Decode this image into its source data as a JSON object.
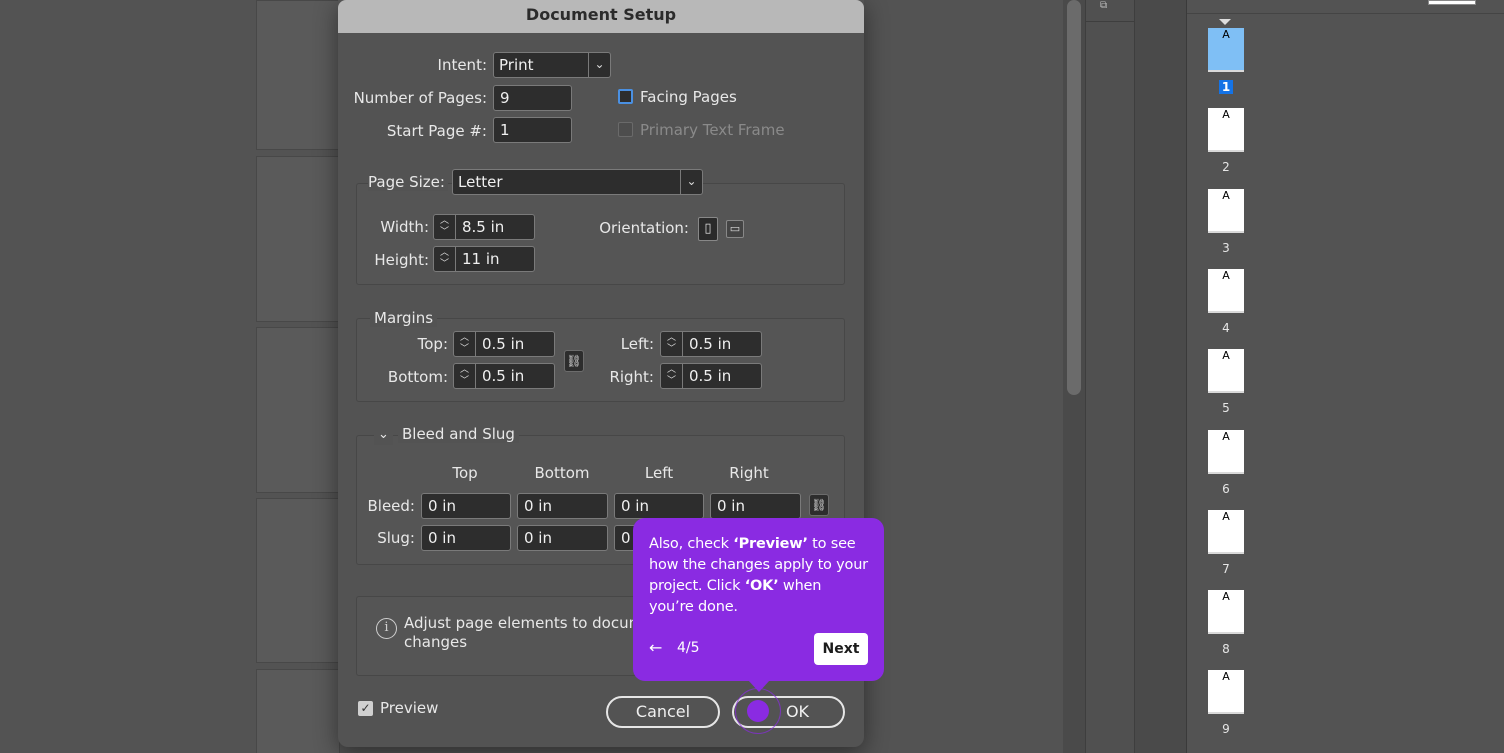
{
  "dialog": {
    "title": "Document Setup",
    "intent_label": "Intent:",
    "intent_value": "Print",
    "num_pages_label": "Number of Pages:",
    "num_pages_value": "9",
    "start_page_label": "Start Page #:",
    "start_page_value": "1",
    "facing_pages_label": "Facing Pages",
    "primary_text_frame_label": "Primary Text Frame",
    "page_size_label": "Page Size:",
    "page_size_value": "Letter",
    "width_label": "Width:",
    "width_value": "8.5 in",
    "height_label": "Height:",
    "height_value": "11 in",
    "orientation_label": "Orientation:",
    "margins_label": "Margins",
    "margin_top_label": "Top:",
    "margin_top_value": "0.5 in",
    "margin_bottom_label": "Bottom:",
    "margin_bottom_value": "0.5 in",
    "margin_left_label": "Left:",
    "margin_left_value": "0.5 in",
    "margin_right_label": "Right:",
    "margin_right_value": "0.5 in",
    "bleed_slug_label": "Bleed and Slug",
    "col_top": "Top",
    "col_bottom": "Bottom",
    "col_left": "Left",
    "col_right": "Right",
    "bleed_label": "Bleed:",
    "slug_label": "Slug:",
    "bleed": {
      "top": "0 in",
      "bottom": "0 in",
      "left": "0 in",
      "right": "0 in"
    },
    "slug": {
      "top": "0 in",
      "bottom": "0 in",
      "left": "0"
    },
    "adjust_line1": "Adjust page elements to docum",
    "adjust_line2": "changes",
    "preview_label": "Preview",
    "cancel_label": "Cancel",
    "ok_label": "OK"
  },
  "tooltip": {
    "text_a": "Also, check ",
    "text_b": "‘Preview’",
    "text_c": " to see how the changes apply to your project. Click ",
    "text_d": "‘OK’",
    "text_e": " when you’re done.",
    "back_icon": "←",
    "step": "4/5",
    "next_label": "Next"
  },
  "pages_panel": {
    "master_letter": "A",
    "pages": [
      "1",
      "2",
      "3",
      "4",
      "5",
      "6",
      "7",
      "8",
      "9"
    ],
    "selected": "1"
  }
}
